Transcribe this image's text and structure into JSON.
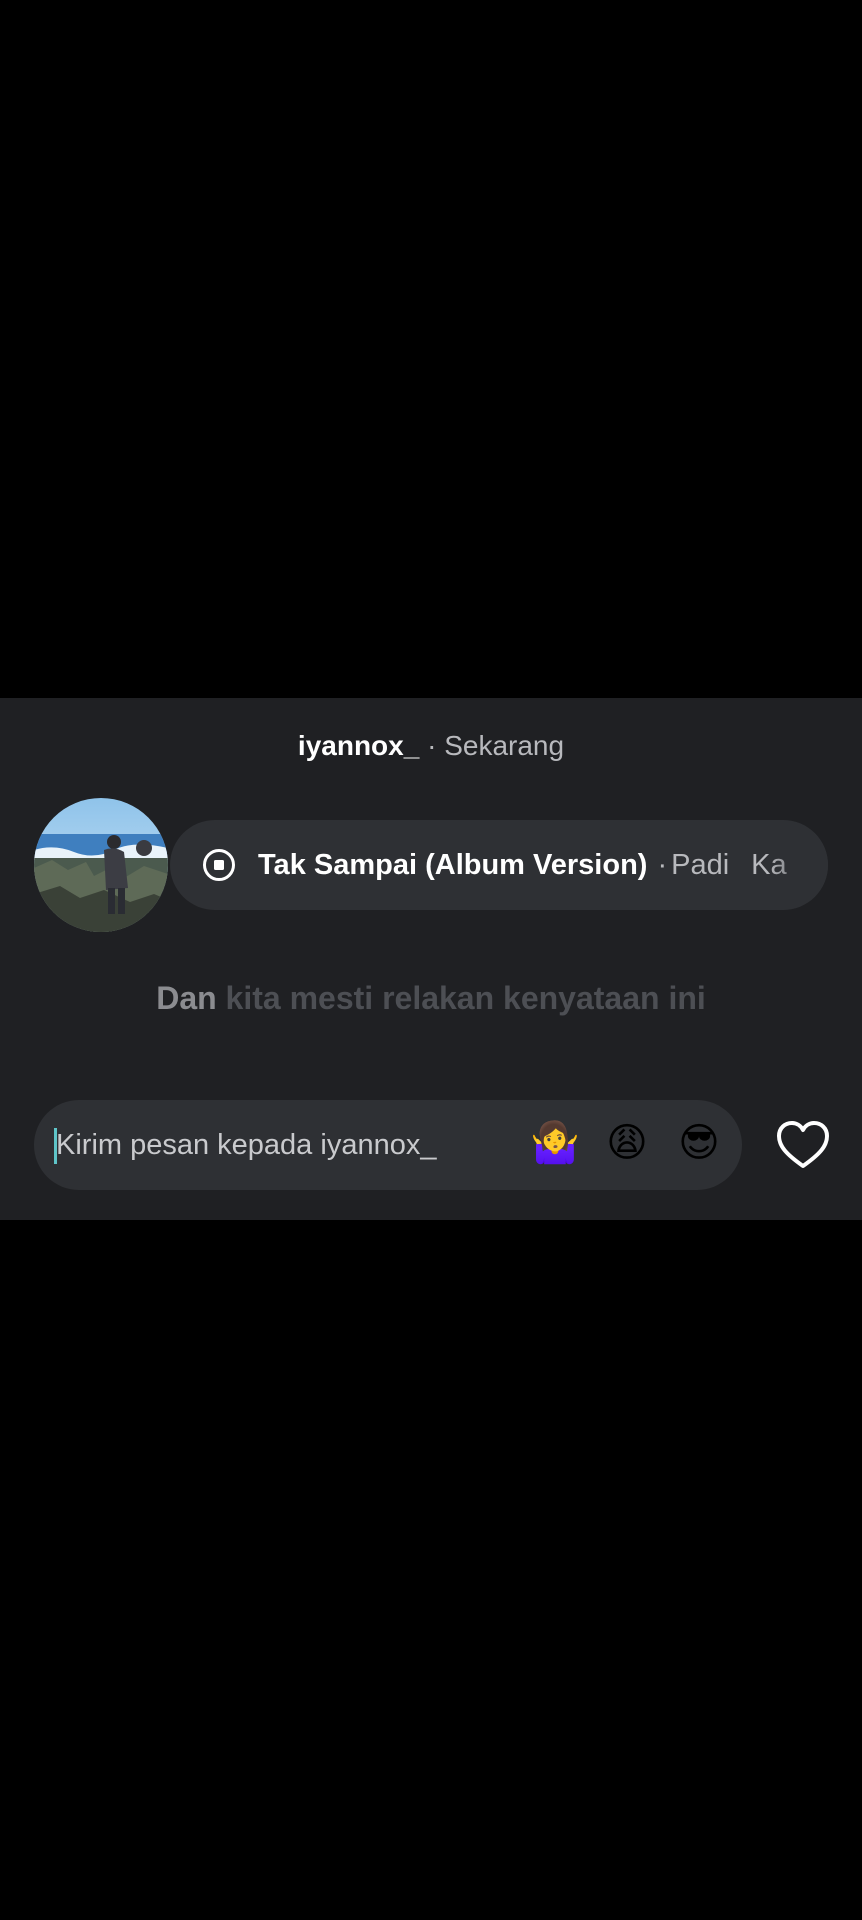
{
  "header": {
    "username": "iyannox_",
    "separator": " · ",
    "time": "Sekarang"
  },
  "music": {
    "icon": "stop-circle-icon",
    "title": "Tak Sampai (Album Version)",
    "separator": "·",
    "artist": "Padi",
    "extra": "Ka"
  },
  "lyric": {
    "sung": "Dan",
    "rest": "kita mesti relakan kenyataan ini"
  },
  "reply": {
    "placeholder": "Kirim pesan kepada iyannox_",
    "quick_reactions": [
      "🤷‍♀️",
      "😩",
      "😎"
    ]
  },
  "colors": {
    "panel_bg": "#1f2023",
    "pill_bg": "#2e3034",
    "cursor": "#5fc5c9"
  },
  "icons": {
    "like": "heart-outline-icon"
  }
}
